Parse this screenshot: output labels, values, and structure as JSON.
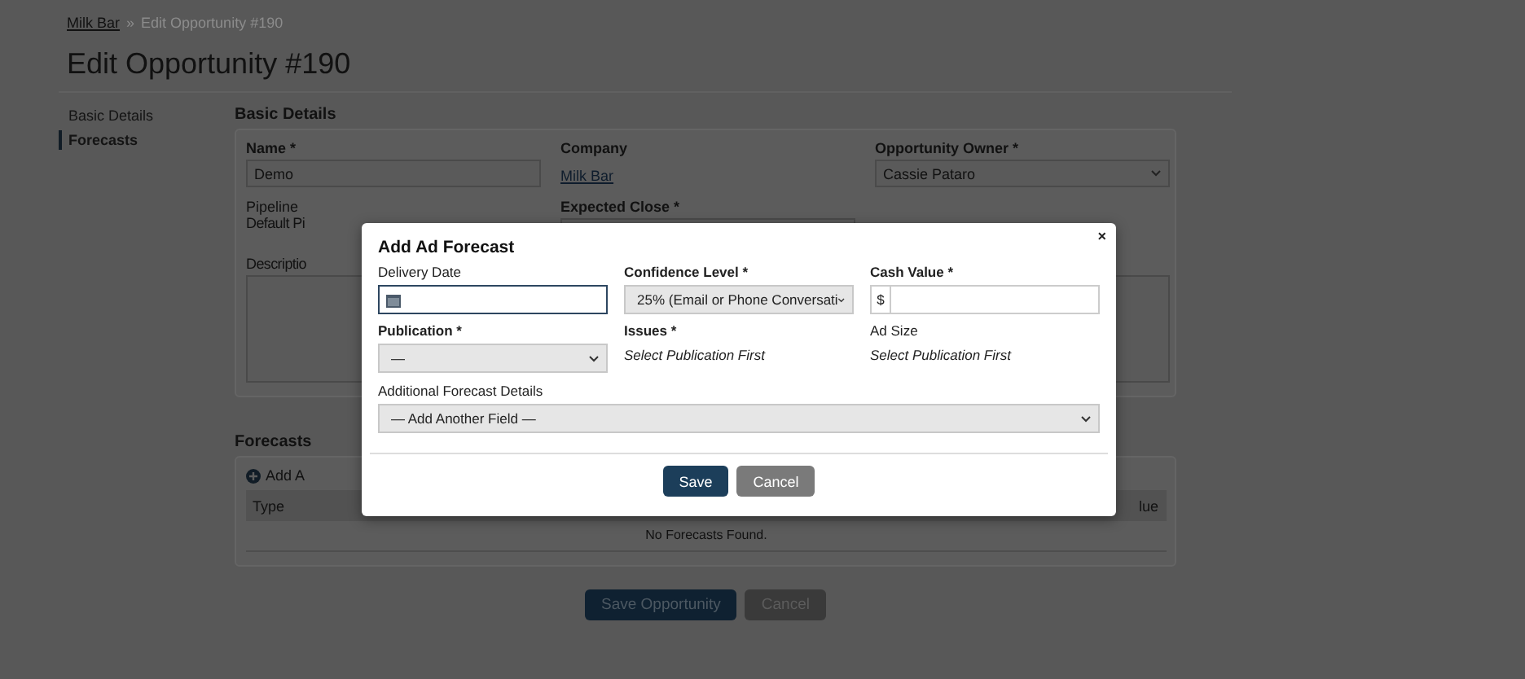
{
  "breadcrumb": {
    "separator": "»",
    "items": [
      {
        "label": "Milk Bar",
        "link": true
      },
      {
        "label": "Edit Opportunity #190",
        "link": false
      }
    ]
  },
  "title": "Edit Opportunity #190",
  "sidebar": {
    "items": [
      {
        "label": "Basic Details",
        "selected": false
      },
      {
        "label": "Forecasts",
        "selected": true
      }
    ]
  },
  "basic_details": {
    "heading": "Basic Details",
    "name": {
      "label": "Name *",
      "value": "Demo"
    },
    "company": {
      "label": "Company",
      "value": "Milk Bar"
    },
    "owner": {
      "label": "Opportunity Owner *",
      "value": "Cassie Pataro"
    },
    "pipeline": {
      "label": "Pipeline",
      "value": "Default Pi"
    },
    "expected_close": {
      "label": "Expected Close *"
    },
    "description": {
      "label": "Descriptio"
    }
  },
  "forecasts": {
    "heading": "Forecasts",
    "add_label": "Add A",
    "columns": [
      "Type",
      "lue"
    ],
    "empty": "No Forecasts Found."
  },
  "actions": [
    {
      "label": "Save Opportunity",
      "kind": "primary"
    },
    {
      "label": "Cancel",
      "kind": "secondary"
    }
  ],
  "modal": {
    "title": "Add Ad Forecast",
    "close": "×",
    "fields": [
      {
        "kind": "date",
        "label": "Delivery Date",
        "focused": true
      },
      {
        "kind": "select",
        "label": "Confidence Level *",
        "value": "25% (Email or Phone Conversati"
      },
      {
        "kind": "money",
        "label": "Cash Value *",
        "prefix": "$"
      },
      {
        "kind": "select",
        "label": "Publication *",
        "value": "—"
      },
      {
        "kind": "note",
        "label": "Issues *",
        "value": "Select Publication First"
      },
      {
        "kind": "note",
        "label": "Ad Size",
        "value": "Select Publication First"
      }
    ],
    "extra": {
      "label": "Additional Forecast Details",
      "value": "— Add Another Field —"
    },
    "buttons": [
      {
        "label": "Save",
        "kind": "primary"
      },
      {
        "label": "Cancel",
        "kind": "secondary"
      }
    ]
  }
}
